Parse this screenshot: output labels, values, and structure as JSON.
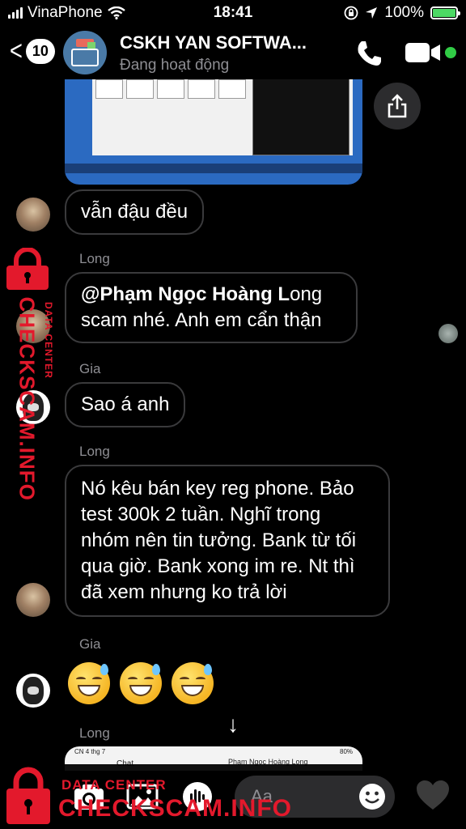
{
  "status_bar": {
    "carrier": "VinaPhone",
    "time": "18:41",
    "battery": "100%",
    "battery_level": 1.0
  },
  "header": {
    "back_count": "10",
    "title": "CSKH YAN SOFTWA...",
    "subtitle": "Đang hoạt động",
    "icons": [
      "chevron-left-icon",
      "phone-icon",
      "video-camera-icon"
    ],
    "online_color": "#31cc46"
  },
  "messages": [
    {
      "sender": "",
      "text": "vẫn đậu đều"
    },
    {
      "sender": "Long",
      "mention": "@Phạm Ngọc Hoàng L",
      "text": "ong scam nhé. Anh em cẩn thận"
    },
    {
      "sender": "Gia",
      "text": "Sao á anh"
    },
    {
      "sender": "Long",
      "text": "Nó kêu bán key reg phone. Bảo test 300k 2 tuần. Nghĩ trong nhóm nên tin tưởng. Bank từ tối qua giờ. Bank xong im re. Nt thì đã xem nhưng ko trả lời"
    },
    {
      "sender": "Gia",
      "emoji_count": 3,
      "emoji": "grinning-sweat-icon"
    },
    {
      "sender": "Long"
    }
  ],
  "preview_strip": {
    "left": "CN 4 thg 7",
    "center_left": "Chat",
    "right": "Phạm Ngọc Hoàng Long",
    "percent": "80%"
  },
  "composer": {
    "placeholder": "Aa"
  },
  "watermark": {
    "small": "DATA CENTER",
    "big": "CHECKSCAM.INFO"
  },
  "colors": {
    "watermark": "#e3192c",
    "bubble_border": "#3a3a3c",
    "muted": "#8e8e93"
  }
}
